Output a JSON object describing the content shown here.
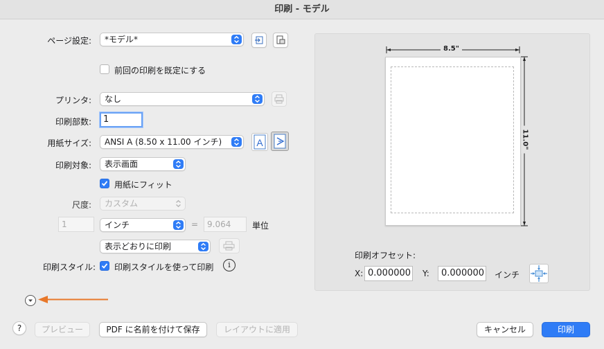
{
  "window": {
    "title": "印刷 - モデル"
  },
  "page_setup": {
    "label": "ページ設定:",
    "value": "*モデル*"
  },
  "use_previous": {
    "label": "前回の印刷を既定にする",
    "checked": false
  },
  "printer": {
    "label": "プリンタ:",
    "value": "なし"
  },
  "copies": {
    "label": "印刷部数:",
    "value": "1"
  },
  "paper_size": {
    "label": "用紙サイズ:",
    "value": "ANSI A (8.50 x 11.00 インチ)"
  },
  "plot_area": {
    "label": "印刷対象:",
    "value": "表示画面"
  },
  "fit_to_paper": {
    "label": "用紙にフィット",
    "checked": true
  },
  "scale": {
    "label": "尺度:",
    "value": "カスタム",
    "num1": "1",
    "unit": "インチ",
    "equals": "=",
    "num2": "9.064",
    "unit_label": "単位"
  },
  "shade": {
    "value": "表示どおりに印刷"
  },
  "plot_style": {
    "label": "印刷スタイル:",
    "check_label": "印刷スタイルを使って印刷",
    "checked": true,
    "info_icon": "i"
  },
  "preview": {
    "width_label": "8.5\"",
    "height_label": "11.0\""
  },
  "offset": {
    "title": "印刷オフセット:",
    "x_label": "X:",
    "x_value": "0.000000",
    "y_label": "Y:",
    "y_value": "0.000000",
    "unit": "インチ"
  },
  "footer": {
    "help": "?",
    "preview_btn": "プレビュー",
    "pdf_btn": "PDF に名前を付けて保存",
    "apply_layout_btn": "レイアウトに適用",
    "cancel_btn": "キャンセル",
    "print_btn": "印刷"
  },
  "colors": {
    "accent": "#2f7cf6",
    "annotation_arrow": "#e8782a"
  }
}
